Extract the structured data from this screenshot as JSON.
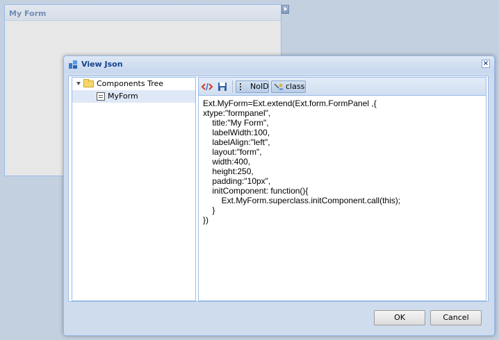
{
  "background_panel": {
    "title": "My Form"
  },
  "window": {
    "title": "View Json",
    "close_label": "×"
  },
  "tree": {
    "root_label": "Components Tree",
    "items": [
      {
        "label": "MyForm",
        "selected": true
      }
    ]
  },
  "toolbar": {
    "noid_label": "NoID",
    "class_label": "class"
  },
  "editor": {
    "code": "Ext.MyForm=Ext.extend(Ext.form.FormPanel ,{\nxtype:\"formpanel\",\n\ttitle:\"My Form\",\n\tlabelWidth:100,\n\tlabelAlign:\"left\",\n\tlayout:\"form\",\n\twidth:400,\n\theight:250,\n\tpadding:\"10px\",\n\tinitComponent: function(){\n\t\tExt.MyForm.superclass.initComponent.call(this);\n\t}\n})"
  },
  "buttons": {
    "ok_label": "OK",
    "cancel_label": "Cancel"
  },
  "colors": {
    "header_text": "#15428b",
    "border": "#99bbe8",
    "selected_row": "#dfe8f6"
  },
  "icons": [
    "collapse-tool-icon",
    "window-app-icon",
    "close-icon",
    "tree-expand-icon",
    "folder-icon",
    "form-icon",
    "code-tags-icon",
    "save-icon",
    "noid-icon",
    "class-icon"
  ]
}
